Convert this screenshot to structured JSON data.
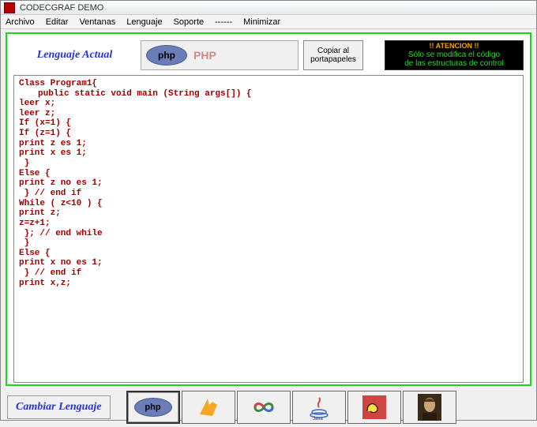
{
  "window": {
    "title": "CODECGRAF DEMO"
  },
  "menu": {
    "archivo": "Archivo",
    "editar": "Editar",
    "ventanas": "Ventanas",
    "lenguaje": "Lenguaje",
    "soporte": "Soporte",
    "dashes": "------",
    "minimizar": "Minimizar"
  },
  "header": {
    "current_label": "Lenguaje Actual",
    "php_badge": "php",
    "php_name": "PHP",
    "copy_button": "Copiar al portapapeles"
  },
  "warning": {
    "line1": "!! ATENCION !!",
    "line2": "Sólo se modifica el código",
    "line3": "de las estructuras de control"
  },
  "code": {
    "l1": "Class Program1{",
    "l2": "public static void main (String args[]) {",
    "l3": "leer x;",
    "l4": "leer z;",
    "l5": "If (x=1) {",
    "l6": "If (z=1) {",
    "l7": "print z es 1;",
    "l8": "print x es 1;",
    "l9": " }",
    "l10": "Else {",
    "l11": "print z no es 1;",
    "l12": " } // end if",
    "l13": "While ( z<10 ) {",
    "l14": "print z;",
    "l15": "z=z+1;",
    "l16": " }; // end while",
    "l17": " }",
    "l18": "Else {",
    "l19": "print x no es 1;",
    "l20": " } // end if",
    "l21": "print x,z;"
  },
  "footer": {
    "change_label": "Cambiar Lenguaje"
  },
  "lang_icons": {
    "php": "php"
  }
}
